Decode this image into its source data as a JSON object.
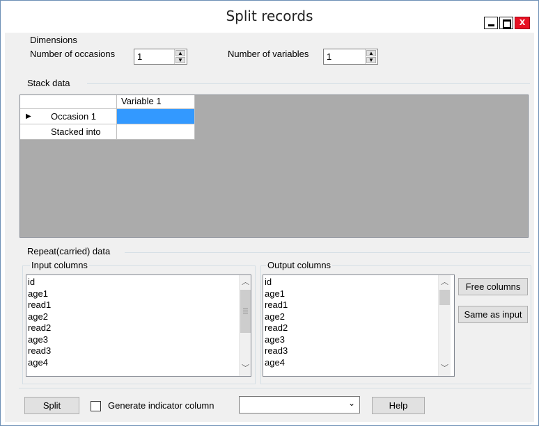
{
  "window": {
    "title": "Split records",
    "close_glyph": "x"
  },
  "dimensions": {
    "group_label": "Dimensions",
    "occasions_label": "Number of occasions",
    "occasions_value": "1",
    "variables_label": "Number of variables",
    "variables_value": "1"
  },
  "stack": {
    "group_label": "Stack data",
    "column_header": "Variable  1",
    "rows": [
      {
        "marker": "▶",
        "label": "Occasion 1"
      },
      {
        "marker": "",
        "label": "Stacked into"
      }
    ]
  },
  "repeat": {
    "group_label": "Repeat(carried) data",
    "input_label": "Input columns",
    "output_label": "Output columns",
    "input_items": [
      "id",
      "age1",
      "read1",
      "age2",
      "read2",
      "age3",
      "read3",
      "age4"
    ],
    "output_items": [
      "id",
      "age1",
      "read1",
      "age2",
      "read2",
      "age3",
      "read3",
      "age4"
    ],
    "free_columns_label": "Free columns",
    "same_as_input_label": "Same as input"
  },
  "footer": {
    "split_label": "Split",
    "indicator_label": "Generate indicator column",
    "combo_value": "",
    "help_label": "Help"
  },
  "icons": {
    "minimize": "minimize-icon",
    "maximize": "maximize-icon",
    "close": "close-icon",
    "scroll_up": "chevron-up-icon",
    "scroll_down": "chevron-down-icon"
  }
}
